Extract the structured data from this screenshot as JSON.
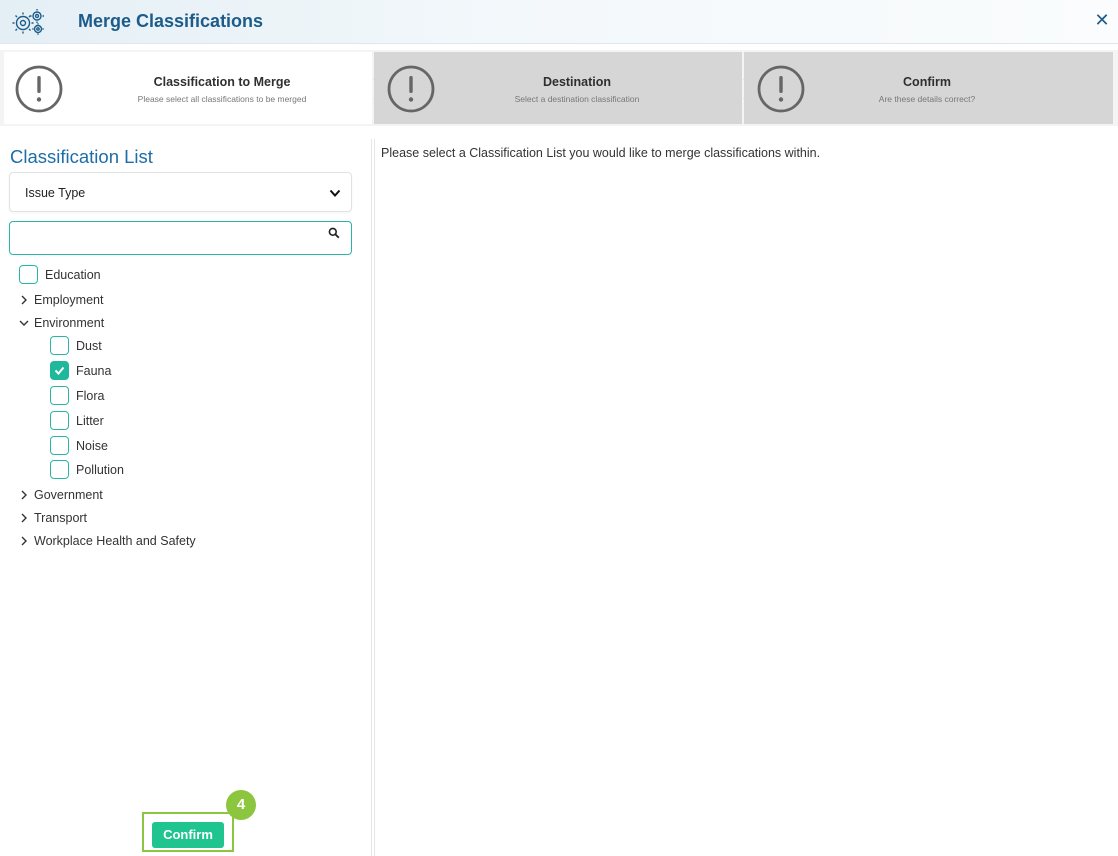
{
  "window": {
    "title": "Merge Classifications",
    "title_icon": "gears-icon",
    "close_icon": "close-icon",
    "close_glyph": "✕"
  },
  "wizard": {
    "steps": [
      {
        "title": "Classification to Merge",
        "subtitle": "Please select all classifications to be merged",
        "icon": "exclamation-circle-icon",
        "active": true
      },
      {
        "title": "Destination",
        "subtitle": "Select a destination classification",
        "icon": "exclamation-circle-icon",
        "active": false
      },
      {
        "title": "Confirm",
        "subtitle": "Are these details correct?",
        "icon": "exclamation-circle-icon",
        "active": false
      }
    ]
  },
  "left": {
    "heading": "Classification List",
    "select": {
      "value": "Issue Type"
    },
    "search": {
      "value": "",
      "placeholder": ""
    },
    "tree": [
      {
        "label": "Education",
        "type": "checkbox",
        "checked": false
      },
      {
        "label": "Employment",
        "type": "collapsed"
      },
      {
        "label": "Environment",
        "type": "expanded"
      },
      {
        "label": "Dust",
        "type": "checkbox",
        "checked": false
      },
      {
        "label": "Fauna",
        "type": "checkbox",
        "checked": true
      },
      {
        "label": "Flora",
        "type": "checkbox",
        "checked": false
      },
      {
        "label": "Litter",
        "type": "checkbox",
        "checked": false
      },
      {
        "label": "Noise",
        "type": "checkbox",
        "checked": false
      },
      {
        "label": "Pollution",
        "type": "checkbox",
        "checked": false
      },
      {
        "label": "Government",
        "type": "collapsed"
      },
      {
        "label": "Transport",
        "type": "collapsed"
      },
      {
        "label": "Workplace Health and Safety",
        "type": "collapsed"
      }
    ]
  },
  "right": {
    "message": "Please select a Classification List you would like to merge classifications within."
  },
  "footer": {
    "confirm_label": "Confirm",
    "step_badge": "4"
  },
  "colors": {
    "accent_teal": "#2bb5a8",
    "checked_green": "#1fb89a",
    "confirm_green": "#1fc48f",
    "highlight_lime": "#8cc63f",
    "title_blue": "#1d5c8a",
    "heading_blue": "#1d6ea7"
  }
}
